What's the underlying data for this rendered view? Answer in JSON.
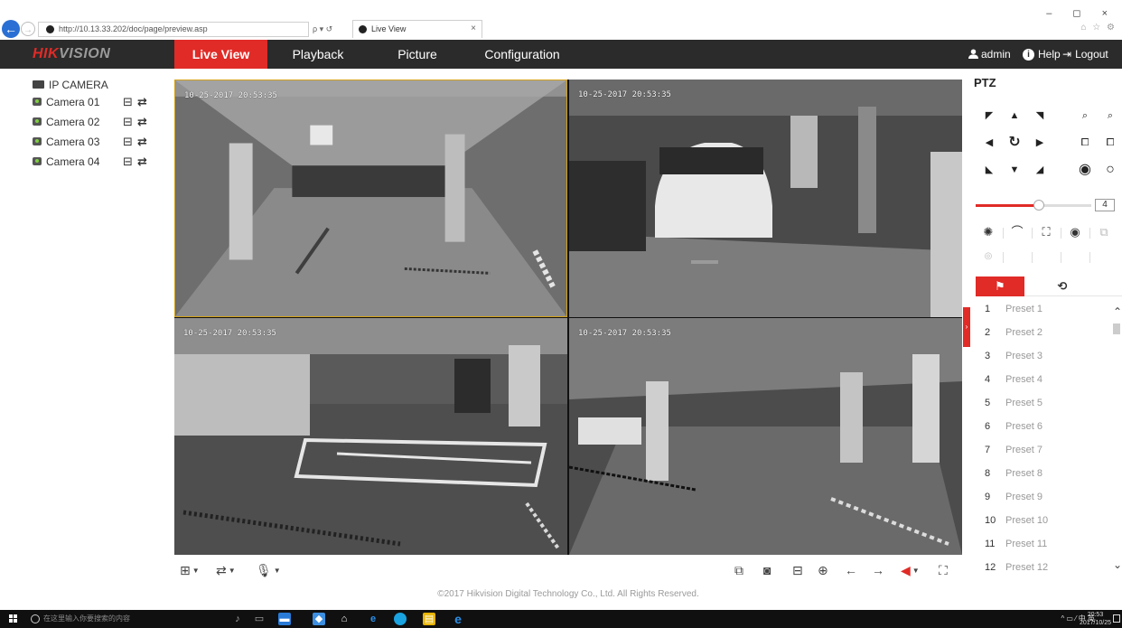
{
  "browser": {
    "url": "http://10.13.33.202/doc/page/preview.asp",
    "search_label": "ρ ▾ ↺",
    "tab_title": "Live View",
    "tab_close": "×",
    "window_controls": "– ◻ ×",
    "tools": "⌂ ☆ ⚙"
  },
  "header": {
    "logo_red": "HIK",
    "logo_grey": "VISION",
    "nav": {
      "live_view": "Live View",
      "playback": "Playback",
      "picture": "Picture",
      "configuration": "Configuration"
    },
    "user": "admin",
    "help": "Help",
    "logout": "Logout"
  },
  "tree": {
    "root_label": "IP CAMERA",
    "cameras": [
      {
        "label": "Camera 01"
      },
      {
        "label": "Camera 02"
      },
      {
        "label": "Camera 03"
      },
      {
        "label": "Camera 04"
      }
    ]
  },
  "video": {
    "timestamps": [
      "10-25-2017 20:53:35",
      "10-25-2017 20:53:35",
      "10-25-2017 20:53:35",
      "10-25-2017 20:53:35"
    ]
  },
  "footer": "©2017 Hikvision Digital Technology Co., Ltd. All Rights Reserved.",
  "ptz": {
    "title": "PTZ",
    "speed": "4",
    "speed_level": 0.55,
    "presets": [
      {
        "num": "1",
        "name": "Preset 1"
      },
      {
        "num": "2",
        "name": "Preset 2"
      },
      {
        "num": "3",
        "name": "Preset 3"
      },
      {
        "num": "4",
        "name": "Preset 4"
      },
      {
        "num": "5",
        "name": "Preset 5"
      },
      {
        "num": "6",
        "name": "Preset 6"
      },
      {
        "num": "7",
        "name": "Preset 7"
      },
      {
        "num": "8",
        "name": "Preset 8"
      },
      {
        "num": "9",
        "name": "Preset 9"
      },
      {
        "num": "10",
        "name": "Preset 10"
      },
      {
        "num": "11",
        "name": "Preset 11"
      },
      {
        "num": "12",
        "name": "Preset 12"
      }
    ]
  },
  "taskbar": {
    "search_placeholder": "在这里输入你要搜索的内容",
    "tray": "^ ▭ ⁄ 中 英",
    "time": "20:53",
    "date": "2017/10/25"
  },
  "colors": {
    "accent": "#e02b27",
    "header_bg": "#2b2b2b",
    "selected_pane_border": "#d4a21a"
  }
}
